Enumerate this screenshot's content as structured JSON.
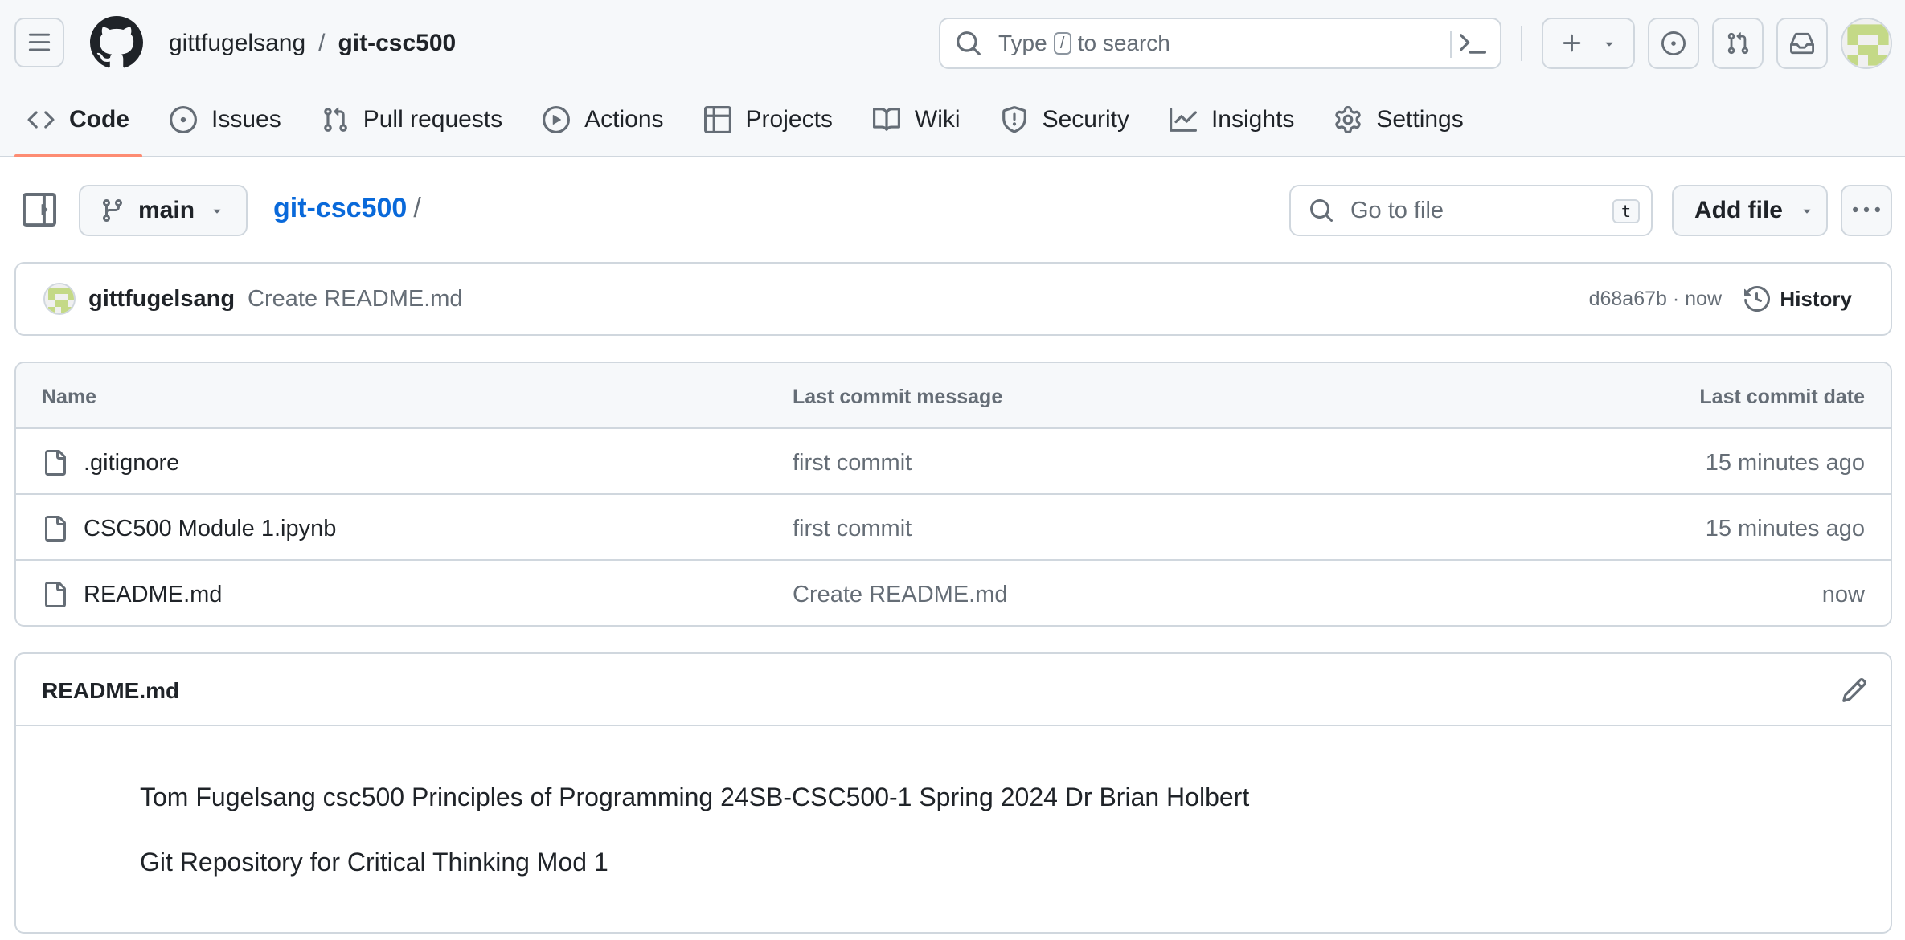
{
  "header": {
    "owner": "gittfugelsang",
    "repo": "git-csc500",
    "search_prefix": "Type",
    "search_key": "/",
    "search_suffix": "to search"
  },
  "icons": {
    "menu": "hamburger-icon",
    "logo": "github-logo",
    "search": "search-icon",
    "terminal": "command-palette-icon",
    "plus": "plus-icon",
    "issues": "issue-circle-icon",
    "pulls": "pull-request-icon",
    "inbox": "inbox-icon"
  },
  "tabs": [
    {
      "label": "Code",
      "icon": "code-icon",
      "active": true
    },
    {
      "label": "Issues",
      "icon": "issue-circle-icon"
    },
    {
      "label": "Pull requests",
      "icon": "pull-request-icon"
    },
    {
      "label": "Actions",
      "icon": "play-icon"
    },
    {
      "label": "Projects",
      "icon": "table-icon"
    },
    {
      "label": "Wiki",
      "icon": "book-icon"
    },
    {
      "label": "Security",
      "icon": "shield-icon"
    },
    {
      "label": "Insights",
      "icon": "graph-icon"
    },
    {
      "label": "Settings",
      "icon": "gear-icon"
    }
  ],
  "toolbar": {
    "branch": "main",
    "repo_link": "git-csc500",
    "path_sep": "/",
    "goto_placeholder": "Go to file",
    "goto_key": "t",
    "add_file": "Add file"
  },
  "commit": {
    "author": "gittfugelsang",
    "message": "Create README.md",
    "meta": "d68a67b · now",
    "history": "History"
  },
  "files": {
    "headers": {
      "name": "Name",
      "message": "Last commit message",
      "date": "Last commit date"
    },
    "rows": [
      {
        "name": ".gitignore",
        "message": "first commit",
        "date": "15 minutes ago"
      },
      {
        "name": "CSC500 Module 1.ipynb",
        "message": "first commit",
        "date": "15 minutes ago"
      },
      {
        "name": "README.md",
        "message": "Create README.md",
        "date": "now"
      }
    ]
  },
  "readme": {
    "title": "README.md",
    "paragraphs": [
      "Tom Fugelsang csc500 Principles of Programming 24SB-CSC500-1 Spring 2024 Dr Brian Holbert",
      "Git Repository for Critical Thinking Mod 1"
    ]
  },
  "colors": {
    "accent_underline": "#fd8c73",
    "link": "#0969da",
    "border": "#d0d7de",
    "muted": "#656d76",
    "avatar_green": "#c4d987"
  }
}
